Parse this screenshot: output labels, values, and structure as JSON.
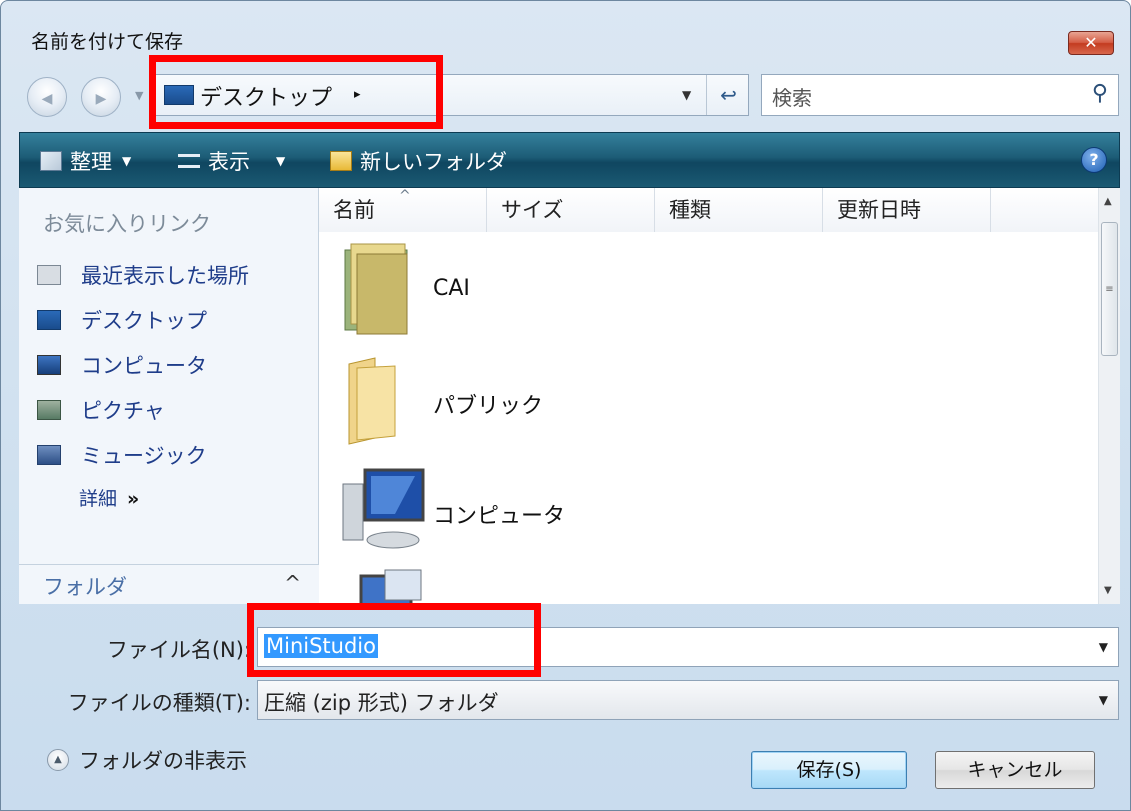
{
  "window": {
    "title": "名前を付けて保存",
    "close_symbol": "✕"
  },
  "address_bar": {
    "location": "デスクトップ",
    "separator_arrow": "▸",
    "refresh_symbol": "↩",
    "back_symbol": "◀",
    "forward_symbol": "▶"
  },
  "search": {
    "placeholder": "検索",
    "icon_symbol": "⚲"
  },
  "toolbar": {
    "organize": "整理",
    "view": "表示",
    "new_folder": "新しいフォルダ",
    "help": "?"
  },
  "sidebar": {
    "header": "お気に入りリンク",
    "items": [
      {
        "label": "最近表示した場所",
        "icon": "recent-places-icon"
      },
      {
        "label": "デスクトップ",
        "icon": "desktop-icon"
      },
      {
        "label": "コンピュータ",
        "icon": "computer-icon"
      },
      {
        "label": "ピクチャ",
        "icon": "pictures-icon"
      },
      {
        "label": "ミュージック",
        "icon": "music-icon"
      }
    ],
    "more": "詳細",
    "more_chevrons": "»",
    "folders": "フォルダ",
    "folders_chevron": "^"
  },
  "file_list": {
    "columns": [
      "名前",
      "サイズ",
      "種類",
      "更新日時"
    ],
    "sort_arrow": "^",
    "items": [
      {
        "name": "CAI",
        "icon": "folder-icon"
      },
      {
        "name": "パブリック",
        "icon": "folder-icon"
      },
      {
        "name": "コンピュータ",
        "icon": "computer-icon"
      },
      {
        "name": "",
        "icon": "network-icon"
      }
    ]
  },
  "form": {
    "filename_label": "ファイル名(N):",
    "filename_value": "MiniStudio",
    "filetype_label": "ファイルの種類(T):",
    "filetype_value": "圧縮 (zip 形式) フォルダ",
    "hide_folders": "フォルダの非表示",
    "save": "保存(S)",
    "cancel": "キャンセル"
  },
  "annotation_color": "#ff0000"
}
